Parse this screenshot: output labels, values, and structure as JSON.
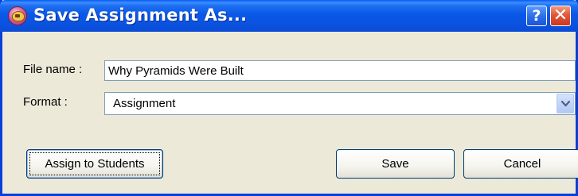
{
  "window": {
    "title": "Save Assignment As...",
    "icons": {
      "app": "app-icon",
      "help": "help-icon",
      "close": "close-icon"
    },
    "help_glyph": "?",
    "close_glyph": "✕"
  },
  "form": {
    "file_name_label": "File name :",
    "file_name_value": "Why Pyramids Were Built",
    "format_label": "Format :",
    "format_value": "Assignment"
  },
  "buttons": {
    "assign": "Assign to Students",
    "save": "Save",
    "cancel": "Cancel"
  },
  "colors": {
    "titlebar": "#0a53e0",
    "frame": "#0a3fd8",
    "dialog_bg": "#ece9d8",
    "close_button": "#e2583a",
    "input_border": "#7f9db9"
  }
}
